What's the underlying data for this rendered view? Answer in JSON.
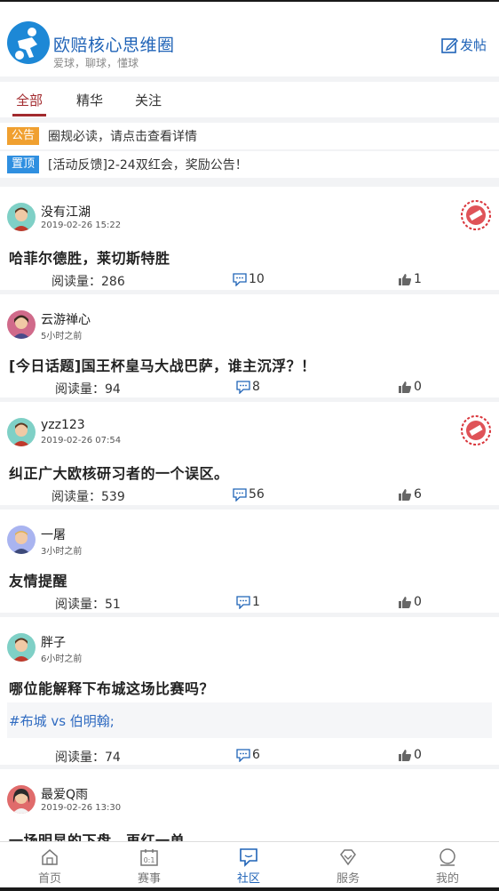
{
  "header": {
    "title": "欧赔核心思维圈",
    "subtitle": "爱球，聊球，懂球",
    "post_label": "发帖"
  },
  "tabs": [
    {
      "label": "全部"
    },
    {
      "label": "精华"
    },
    {
      "label": "关注"
    }
  ],
  "notices": [
    {
      "tag": "公告",
      "tag_color": "#f0a030",
      "text": "圈规必读，请点击查看详情"
    },
    {
      "tag": "置顶",
      "tag_color": "#2f8fe0",
      "text": "[活动反馈]2-24双红会，奖励公告！"
    }
  ],
  "posts": [
    {
      "user": "没有江湖",
      "time": "2019-02-26 15:22",
      "title": "哈菲尔德胜，莱切斯特胜",
      "reads": "阅读量：286",
      "comments": "10",
      "likes": "1",
      "hot": true
    },
    {
      "user": "云游禅心",
      "time": "5小时之前",
      "title": "[今日话题]国王杯皇马大战巴萨，谁主沉浮？！",
      "reads": "阅读量：94",
      "comments": "8",
      "likes": "0",
      "hot": false
    },
    {
      "user": "yzz123",
      "time": "2019-02-26 07:54",
      "title": "纠正广大欧核研习者的一个误区。",
      "reads": "阅读量：539",
      "comments": "56",
      "likes": "6",
      "hot": true
    },
    {
      "user": "一屠",
      "time": "3小时之前",
      "title": "友情提醒",
      "reads": "阅读量：51",
      "comments": "1",
      "likes": "0",
      "hot": false
    },
    {
      "user": "胖子",
      "time": "6小时之前",
      "title": "哪位能解释下布城这场比赛吗？",
      "hashtag": "#布城 vs 伯明翰;",
      "reads": "阅读量：74",
      "comments": "6",
      "likes": "0",
      "hot": false
    },
    {
      "user": "最爱Q雨",
      "time": "2019-02-26 13:30",
      "title": "一场明显的下盘，再红一单",
      "hot": false
    }
  ],
  "bottom_nav": [
    {
      "label": "首页",
      "icon": "home-icon"
    },
    {
      "label": "赛事",
      "icon": "scoreboard-icon"
    },
    {
      "label": "社区",
      "icon": "chat-icon",
      "active": true
    },
    {
      "label": "服务",
      "icon": "diamond-icon"
    },
    {
      "label": "我的",
      "icon": "profile-icon"
    }
  ],
  "colors": {
    "brand_blue": "#1f63b7",
    "tab_active": "#a22a2e",
    "hot_badge": "#d9353b"
  }
}
